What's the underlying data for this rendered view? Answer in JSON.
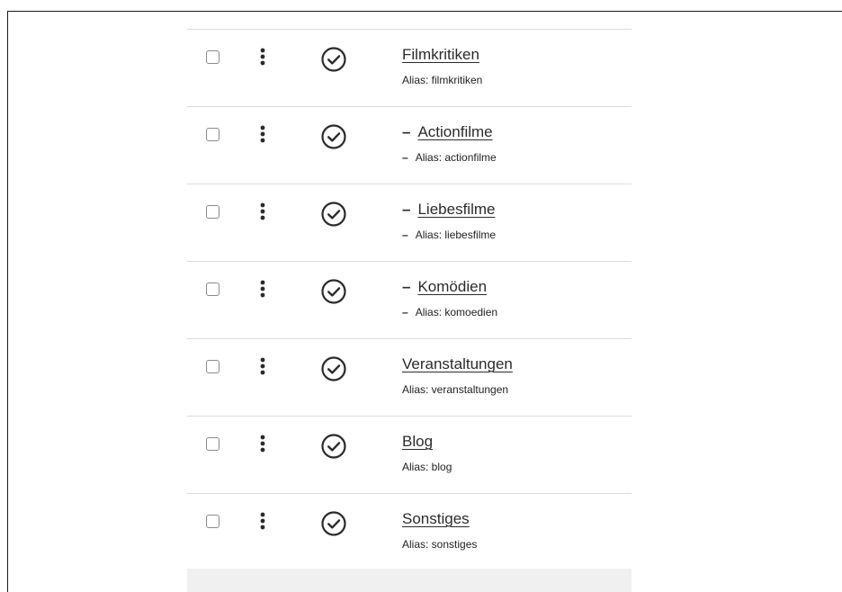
{
  "categories": [
    {
      "title": "Filmkritiken",
      "alias": "Alias: filmkritiken",
      "dash": ""
    },
    {
      "title": "Actionfilme",
      "alias": "Alias: actionfilme",
      "dash": "–"
    },
    {
      "title": "Liebesfilme",
      "alias": "Alias: liebesfilme",
      "dash": "–"
    },
    {
      "title": "Komödien",
      "alias": "Alias: komoedien",
      "dash": "–"
    },
    {
      "title": "Veranstaltungen",
      "alias": "Alias: veranstaltungen",
      "dash": ""
    },
    {
      "title": "Blog",
      "alias": "Alias: blog",
      "dash": ""
    },
    {
      "title": "Sonstiges",
      "alias": "Alias: sonstiges",
      "dash": ""
    }
  ],
  "icons": {
    "actions": "more-vertical-icon",
    "status": "check-circle-icon"
  },
  "colors": {
    "text": "#2b2b2b",
    "border": "#dcdcdc",
    "icon": "#2b2b2b"
  }
}
